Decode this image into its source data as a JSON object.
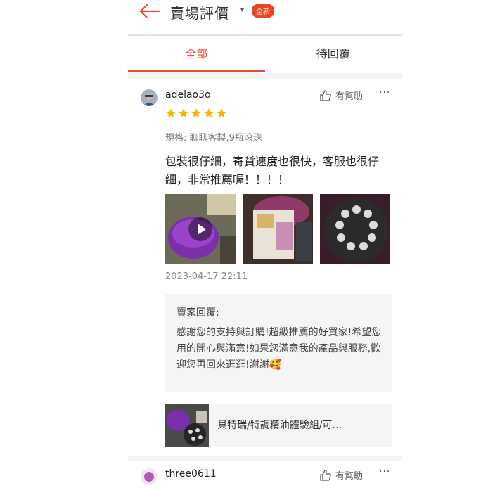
{
  "header": {
    "title": "賣場評價",
    "badge": "全新"
  },
  "tabs": [
    {
      "label": "全部",
      "active": true
    },
    {
      "label": "待回覆",
      "active": false
    }
  ],
  "reviews": [
    {
      "username": "adelao3o",
      "rating": 5,
      "helpful_label": "有幫助",
      "spec": "規格: 聊聊客製,9瓶滾珠",
      "content": "包裝很仔細，寄貨速度也很快，客服也很仔細，非常推薦喔！！！！",
      "media_count": 3,
      "timestamp": "2023-04-17 22:11",
      "seller_reply": {
        "title": "賣家回覆:",
        "text": "感謝您的支持與訂購!超級推薦的好買家!希望您用的開心與滿意!如果您滿意我的產品與服務,歡迎您再回來逛逛!謝謝🥰"
      },
      "product": {
        "name": "貝特瑞/特調精油體驗組/可…"
      }
    },
    {
      "username": "three0611",
      "helpful_label": "有幫助"
    }
  ],
  "colors": {
    "accent": "#ee4d2d",
    "star": "#f5b400",
    "badge": "#e8461f"
  }
}
